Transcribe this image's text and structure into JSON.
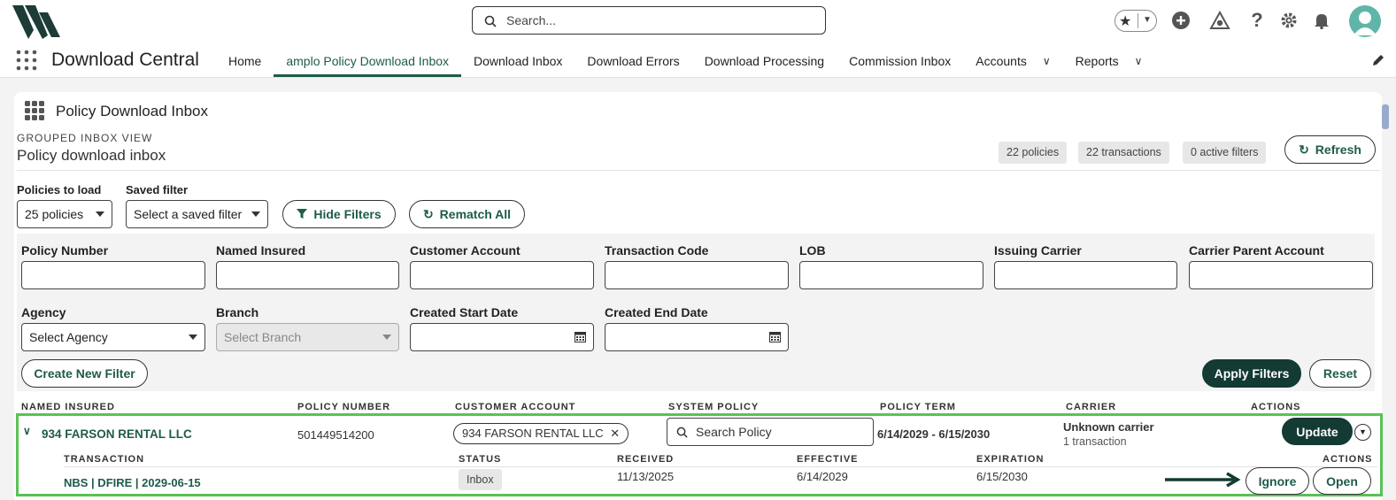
{
  "search": {
    "placeholder": "Search..."
  },
  "header": {
    "app_title": "Download Central",
    "tabs": [
      {
        "label": "Home"
      },
      {
        "label": "amplo Policy Download Inbox",
        "active": true
      },
      {
        "label": "Download Inbox"
      },
      {
        "label": "Download Errors"
      },
      {
        "label": "Download Processing"
      },
      {
        "label": "Commission Inbox"
      },
      {
        "label": "Accounts",
        "has_dropdown": true
      },
      {
        "label": "Reports",
        "has_dropdown": true
      }
    ]
  },
  "card": {
    "title": "Policy Download Inbox",
    "eyebrow": "GROUPED INBOX VIEW",
    "subtitle": "Policy download inbox",
    "pills": [
      "22 policies",
      "22 transactions",
      "0 active filters"
    ],
    "refresh_label": "Refresh"
  },
  "controls": {
    "policies_to_load_label": "Policies to load",
    "policies_to_load_value": "25 policies",
    "saved_filter_label": "Saved filter",
    "saved_filter_value": "Select a saved filter",
    "hide_filters_label": "Hide Filters",
    "rematch_all_label": "Rematch All"
  },
  "filters": {
    "policy_number": "Policy Number",
    "named_insured": "Named Insured",
    "customer_account": "Customer Account",
    "transaction_code": "Transaction Code",
    "lob": "LOB",
    "issuing_carrier": "Issuing Carrier",
    "carrier_parent_account": "Carrier Parent Account",
    "agency": "Agency",
    "agency_value": "Select Agency",
    "branch": "Branch",
    "branch_value": "Select Branch",
    "created_start_date": "Created Start Date",
    "created_end_date": "Created End Date",
    "create_new_filter": "Create New Filter",
    "apply_filters": "Apply Filters",
    "reset": "Reset"
  },
  "table": {
    "columns": [
      "NAMED INSURED",
      "POLICY NUMBER",
      "CUSTOMER ACCOUNT",
      "SYSTEM POLICY",
      "POLICY TERM",
      "CARRIER",
      "ACTIONS"
    ],
    "group": {
      "named_insured": "934 FARSON RENTAL LLC",
      "policy_number": "501449514200",
      "customer_account": "934 FARSON RENTAL LLC",
      "system_policy_placeholder": "Search Policy",
      "policy_term": "6/14/2029 - 6/15/2030",
      "carrier": "Unknown carrier",
      "transaction_count": "1 transaction",
      "update_label": "Update"
    },
    "sub_columns": [
      "TRANSACTION",
      "STATUS",
      "RECEIVED",
      "EFFECTIVE",
      "EXPIRATION",
      "ACTIONS"
    ],
    "transaction": {
      "name": "NBS | DFIRE | 2029-06-15",
      "status": "Inbox",
      "received": "11/13/2025",
      "effective": "6/14/2029",
      "expiration": "6/15/2030",
      "ignore_label": "Ignore",
      "open_label": "Open"
    }
  },
  "colors": {
    "accent": "#1e5b4b",
    "dark_button": "#133a33",
    "highlight": "#58c256"
  }
}
